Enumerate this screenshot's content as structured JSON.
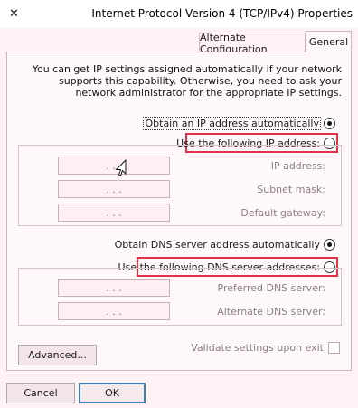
{
  "window": {
    "title": "Internet Protocol Version 4 (TCP/IPv4) Properties",
    "close_glyph": "✕"
  },
  "tabs": [
    {
      "label": "General",
      "active": true
    },
    {
      "label": "Alternate Configuration",
      "active": false
    }
  ],
  "intro_text": "You can get IP settings assigned automatically if your network supports this capability. Otherwise, you need to ask your network administrator for the appropriate IP settings.",
  "ip_section": {
    "auto_label": "Obtain an IP address automatically",
    "manual_label": "Use the following IP address:",
    "fields": [
      {
        "label": "IP address:",
        "value": ". . ."
      },
      {
        "label": "Subnet mask:",
        "value": ". . ."
      },
      {
        "label": "Default gateway:",
        "value": ". . ."
      }
    ]
  },
  "dns_section": {
    "auto_label": "Obtain DNS server address automatically",
    "manual_label": "Use the following DNS server addresses:",
    "fields": [
      {
        "label": "Preferred DNS server:",
        "value": ". . ."
      },
      {
        "label": "Alternate DNS server:",
        "value": ". . ."
      }
    ]
  },
  "validate_label": "Validate settings upon exit",
  "buttons": {
    "advanced": "Advanced...",
    "ok": "OK",
    "cancel": "Cancel"
  },
  "colors": {
    "highlight": "#e0334a",
    "default_button_border": "#3c7fb1"
  }
}
